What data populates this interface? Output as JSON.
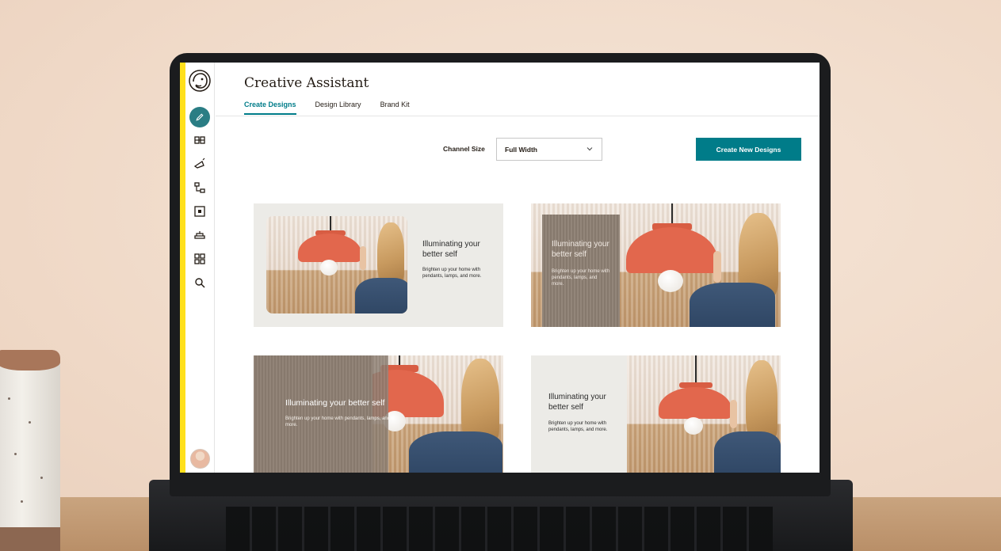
{
  "app": {
    "title": "Creative Assistant"
  },
  "tabs": [
    {
      "label": "Create Designs",
      "active": true
    },
    {
      "label": "Design Library",
      "active": false
    },
    {
      "label": "Brand Kit",
      "active": false
    }
  ],
  "toolbar": {
    "channel_label": "Channel Size",
    "channel_value": "Full Width",
    "create_button": "Create New Designs"
  },
  "sidebar": {
    "items": [
      {
        "icon": "mailchimp-logo"
      },
      {
        "icon": "pencil-icon",
        "active": true
      },
      {
        "icon": "audience-icon"
      },
      {
        "icon": "campaign-icon"
      },
      {
        "icon": "automation-icon"
      },
      {
        "icon": "content-icon"
      },
      {
        "icon": "integrations-icon"
      },
      {
        "icon": "grid-icon"
      },
      {
        "icon": "search-icon"
      }
    ]
  },
  "designs": [
    {
      "title": "Illuminating your better self",
      "body": "Brighten up your home with pendants, lamps, and more."
    },
    {
      "title": "Illuminating your better self",
      "body": "Brighten up your home with pendants, lamps, and more."
    },
    {
      "title": "Illuminating your better self",
      "body": "Brighten up your home with pendants, lamps, and more."
    },
    {
      "title": "Illuminating your better self",
      "body": "Brighten up your home with pendants, lamps, and more."
    }
  ],
  "colors": {
    "accent": "#007c89",
    "brand_yellow": "#ffe01b",
    "lamp_orange": "#e2674d"
  }
}
